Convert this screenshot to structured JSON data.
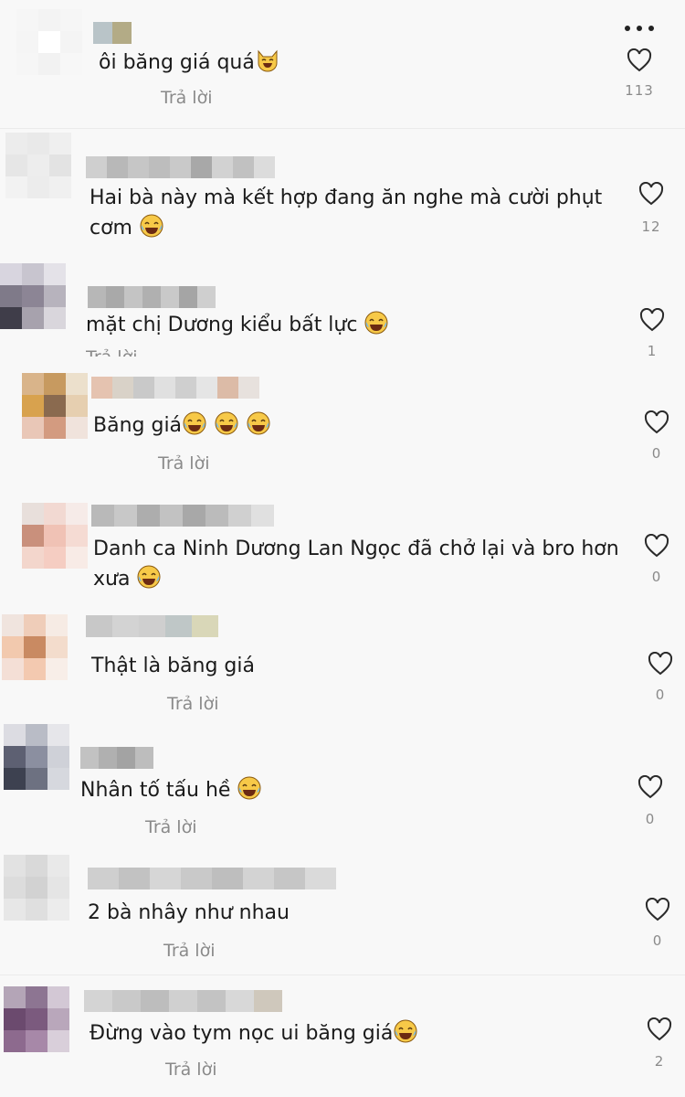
{
  "more_icon": "more-dots-icon",
  "reply_label": "Trả lời",
  "comments": [
    {
      "text": "ôi băng giá quá",
      "emoji": "cat-laughing",
      "likes": "113",
      "reply": "Trả lời",
      "avatar": [
        "#f6f6f6",
        "#f3f3f3",
        "#f6f6f6",
        "#f5f5f5",
        "#ffffff",
        "#f4f4f4",
        "#f6f6f6",
        "#f2f2f2",
        "#f7f7f7"
      ],
      "username_blocks": [
        "#b9c4c8",
        "#b3ab86"
      ]
    },
    {
      "text": "Hai bà này mà kết hợp đang ăn nghe mà cười phụt\ncơm",
      "emoji": "face-tears-of-joy",
      "likes": "12",
      "avatar": [
        "#ececec",
        "#e9e9e9",
        "#efefef",
        "#e6e6e6",
        "#ededed",
        "#e3e3e3",
        "#f2f2f2",
        "#ececec",
        "#f0f0f0"
      ],
      "username_blocks": [
        "#cfcfcf",
        "#b8b8b8",
        "#c6c6c6",
        "#bdbdbd",
        "#c9c9c9",
        "#a8a8a8",
        "#d2d2d2",
        "#c1c1c1",
        "#dcdcdc"
      ]
    },
    {
      "text": "mặt chị Dương kiểu bất lực",
      "emoji": "face-tears-of-joy",
      "likes": "1",
      "avatar": [
        "#d8d5df",
        "#c8c5cf",
        "#e4e2e8",
        "#7f7a89",
        "#8c8595",
        "#b7b3bd",
        "#3f3d49",
        "#a7a2ad",
        "#d9d6dc"
      ],
      "username_blocks": [
        "#b7b7b7",
        "#a9a9a9",
        "#c4c4c4",
        "#b0b0b0",
        "#c9c9c9",
        "#a5a5a5",
        "#cfcfcf"
      ]
    },
    {
      "text": "Băng giá",
      "emoji": "face-tears-of-joy",
      "emoji_count": 3,
      "likes": "0",
      "reply": "Trả lời",
      "avatar": [
        "#d9b48a",
        "#c79a60",
        "#ece0cc",
        "#d8a24e",
        "#8a6a4f",
        "#e6cfb0",
        "#e9c7b7",
        "#d39b80",
        "#f0e3dc"
      ],
      "username_blocks": [
        "#e5c3b0",
        "#d9d2c8",
        "#c9c9c9",
        "#e0e0e0",
        "#cfcfcf",
        "#e5e5e5",
        "#dcbba7",
        "#e7e1dd"
      ]
    },
    {
      "text": "Danh ca Ninh Dương Lan Ngọc đã chở lại và bro hơn\nxưa",
      "emoji": "face-tears-of-joy",
      "likes": "0",
      "avatar": [
        "#e8dfdb",
        "#f2d9d2",
        "#f6ebe8",
        "#c9907c",
        "#f0c2b5",
        "#f5dbd3",
        "#f3d6cc",
        "#f5cdc2",
        "#f8ebe6"
      ],
      "username_blocks": [
        "#b9b9b9",
        "#c8c8c8",
        "#adadad",
        "#c2c2c2",
        "#a8a8a8",
        "#bbbbbb",
        "#d0d0d0",
        "#e0e0e0"
      ]
    },
    {
      "text": "Thật là băng giá",
      "emoji": "",
      "likes": "0",
      "reply": "Trả lời",
      "avatar": [
        "#f0e4de",
        "#efcdb9",
        "#f6ebe4",
        "#f2c9ae",
        "#c98a62",
        "#f3dccc",
        "#f4dfd6",
        "#f3c9b0",
        "#f8eee8"
      ],
      "username_blocks": [
        "#c8c8c8",
        "#d3d3d3",
        "#cfcfcf",
        "#bfc7c7",
        "#d9d7b8"
      ]
    },
    {
      "text": "Nhân tố tấu hề",
      "emoji": "face-tears-of-joy",
      "likes": "0",
      "reply": "Trả lời",
      "avatar": [
        "#dcdce2",
        "#b9bcc6",
        "#e6e6ea",
        "#5d6072",
        "#8b8fa0",
        "#cfd1d8",
        "#3d4150",
        "#6d7181",
        "#d6d8de"
      ],
      "username_blocks": [
        "#c2c2c2",
        "#b0b0b0",
        "#a3a3a3",
        "#bdbdbd"
      ]
    },
    {
      "text": "2 bà nhây như nhau",
      "emoji": "",
      "likes": "0",
      "reply": "Trả lời",
      "avatar": [
        "#e2e2e2",
        "#d9d9d9",
        "#e9e9e9",
        "#dcdcdc",
        "#d2d2d2",
        "#e5e5e5",
        "#e7e7e7",
        "#dfdfdf",
        "#ececec"
      ],
      "username_blocks": [
        "#cfcfcf",
        "#c2c2c2",
        "#d6d6d6",
        "#c9c9c9",
        "#bebebe",
        "#d3d3d3",
        "#c6c6c6",
        "#dadada"
      ]
    },
    {
      "text": "Đừng vào tym nọc ui băng giá",
      "emoji": "face-tears-of-joy",
      "likes": "2",
      "reply": "Trả lời",
      "avatar": [
        "#b4a5b7",
        "#8d7592",
        "#d3c8d5",
        "#6b4a6e",
        "#7b5a7e",
        "#b9a7bb",
        "#8d6a8e",
        "#a788a8",
        "#d9cfda"
      ],
      "username_blocks": [
        "#d4d4d4",
        "#c9c9c9",
        "#bdbdbd",
        "#d0d0d0",
        "#c3c3c3",
        "#d8d8d8",
        "#cfc8bc"
      ]
    }
  ]
}
